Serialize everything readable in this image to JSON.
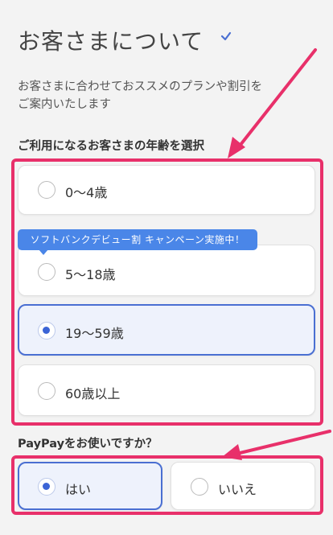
{
  "header": {
    "title": "お客さまについて",
    "check_icon": "check-icon"
  },
  "intro": {
    "line1": "お客さまに合わせておススメのプランや割引を",
    "line2": "ご案内いたします"
  },
  "age_section": {
    "question": "ご利用になるお客さまの年齢を選択",
    "tooltip": "ソフトバンクデビュー割 キャンペーン実施中！",
    "options": [
      {
        "label": "0〜4歳",
        "selected": false
      },
      {
        "label": "5〜18歳",
        "selected": false
      },
      {
        "label": "19〜59歳",
        "selected": true
      },
      {
        "label": "60歳以上",
        "selected": false
      }
    ]
  },
  "paypay_section": {
    "question": "PayPayをお使いですか？",
    "options": [
      {
        "label": "はい",
        "selected": true
      },
      {
        "label": "いいえ",
        "selected": false
      }
    ]
  },
  "colors": {
    "highlight": "#e8306a",
    "accent": "#3b64d6",
    "tooltip": "#4a86e8",
    "selected_bg": "#eef2fc"
  }
}
